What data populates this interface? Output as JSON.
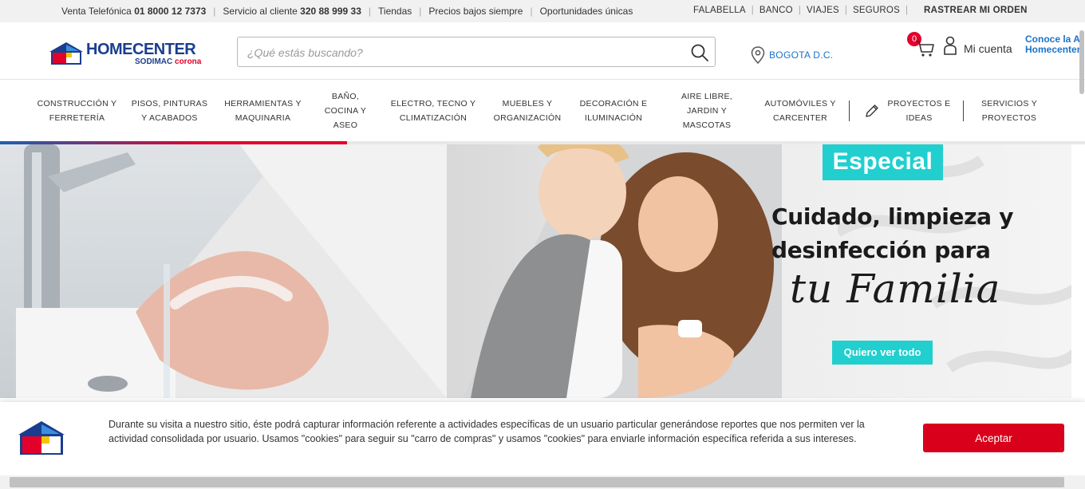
{
  "topbar": {
    "venta_label": "Venta Telefónica",
    "venta_number": "01 8000 12 7373",
    "servicio_label": "Servicio al cliente",
    "servicio_number": "320 88 999 33",
    "tiendas": "Tiendas",
    "precios": "Precios bajos siempre",
    "oportunidades": "Oportunidades únicas",
    "links": [
      "FALABELLA",
      "BANCO",
      "VIAJES",
      "SEGUROS"
    ],
    "rastrear": "RASTREAR MI ORDEN"
  },
  "header": {
    "brand": "HOMECENTER",
    "sub_brand": "SODIMAC",
    "sub_brand_2": "corona",
    "search_placeholder": "¿Qué estás buscando?",
    "location": "BOGOTA D.C.",
    "cart_count": "0",
    "account_label": "Mi cuenta",
    "conoce_line1": "Conoce la A",
    "conoce_line2": "Homecenter"
  },
  "categories": [
    {
      "label_1": "CONSTRUCCIÓN Y",
      "label_2": "FERRETERÍA",
      "label_3": ""
    },
    {
      "label_1": "PISOS, PINTURAS",
      "label_2": "Y ACABADOS",
      "label_3": ""
    },
    {
      "label_1": "HERRAMIENTAS Y",
      "label_2": "MAQUINARIA",
      "label_3": ""
    },
    {
      "label_1": "BAÑO,",
      "label_2": "COCINA Y",
      "label_3": "ASEO"
    },
    {
      "label_1": "ELECTRO, TECNO Y",
      "label_2": "CLIMATIZACIÓN",
      "label_3": ""
    },
    {
      "label_1": "MUEBLES Y",
      "label_2": "ORGANIZACIÓN",
      "label_3": ""
    },
    {
      "label_1": "DECORACIÓN E",
      "label_2": "ILUMINACIÓN",
      "label_3": ""
    },
    {
      "label_1": "AIRE LIBRE,",
      "label_2": "JARDIN Y",
      "label_3": "MASCOTAS"
    },
    {
      "label_1": "AUTOMÓVILES Y",
      "label_2": "CARCENTER",
      "label_3": ""
    },
    {
      "label_1": "PROYECTOS E",
      "label_2": "IDEAS",
      "label_3": ""
    },
    {
      "label_1": "SERVICIOS Y",
      "label_2": "PROYECTOS",
      "label_3": ""
    }
  ],
  "hero": {
    "badge": "Especial",
    "headline_1": "Cuidado, limpieza y",
    "headline_2": "desinfección para",
    "script": "tu Familia",
    "cta": "Quiero ver todo",
    "carousel_progress": 0.32
  },
  "cookie": {
    "text": "Durante su visita a nuestro sitio, éste podrá capturar información referente a actividades específicas de un usuario particular generándose reportes que nos permiten ver la actividad consolidada por usuario. Usamos \"cookies\" para seguir su \"carro de compras\" y usamos \"cookies\" para enviarle información específica referida a sus intereses.",
    "accept": "Aceptar"
  },
  "colors": {
    "brand_blue": "#1a3d8f",
    "brand_red": "#e3002b",
    "accent_cyan": "#21cfcf",
    "link_blue": "#1a73c8"
  }
}
